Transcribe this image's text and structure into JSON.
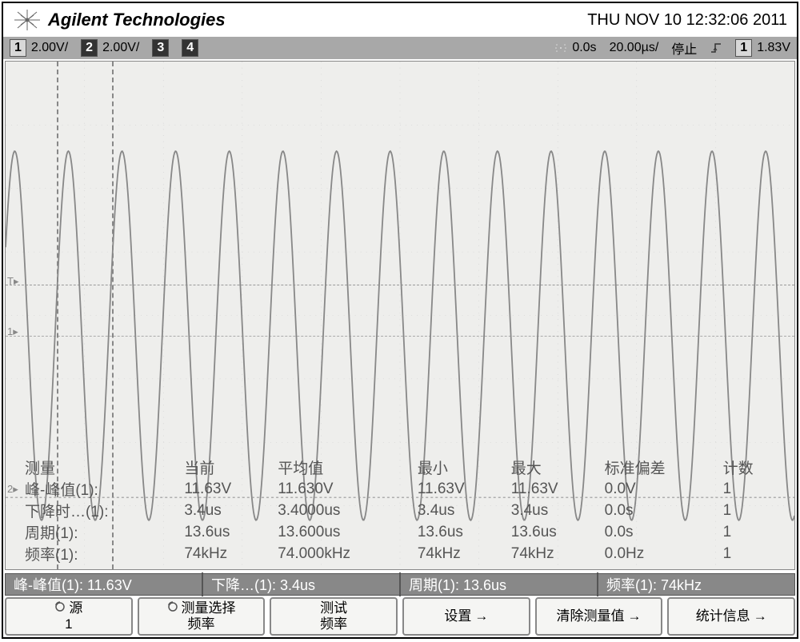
{
  "brand": "Agilent Technologies",
  "timestamp": "THU NOV 10 12:32:06 2011",
  "topbar": {
    "ch1": "1",
    "ch1_vdiv": "2.00V/",
    "ch2": "2",
    "ch2_vdiv": "2.00V/",
    "ch3": "3",
    "ch4": "4",
    "time_pos": "0.0s",
    "time_div": "20.00µs/",
    "run_state": "停止",
    "trig_ch": "1",
    "trig_level": "1.83V"
  },
  "chart_data": {
    "type": "line",
    "signal": "sine",
    "vpp": 11.63,
    "period_us": 13.6,
    "frequency_khz": 74,
    "fall_time_us": 3.4,
    "vdiv": 2.0,
    "time_div_us": 20.0,
    "cycles_visible": 14.7,
    "cursor1_x_div": 0.65,
    "cursor2_x_div": 1.35
  },
  "measurements": {
    "headers": {
      "name": "测量",
      "current": "当前",
      "mean": "平均值",
      "min": "最小",
      "max": "最大",
      "stddev": "标准偏差",
      "count": "计数"
    },
    "rows": [
      {
        "name": "峰-峰值(1):",
        "current": "11.63V",
        "mean": "11.630V",
        "min": "11.63V",
        "max": "11.63V",
        "stddev": "0.0V",
        "count": "1"
      },
      {
        "name": "下降时…(1):",
        "current": "3.4us",
        "mean": "3.4000us",
        "min": "3.4us",
        "max": "3.4us",
        "stddev": "0.0s",
        "count": "1"
      },
      {
        "name": "周期(1):",
        "current": "13.6us",
        "mean": "13.600us",
        "min": "13.6us",
        "max": "13.6us",
        "stddev": "0.0s",
        "count": "1"
      },
      {
        "name": "频率(1):",
        "current": "74kHz",
        "mean": "74.000kHz",
        "min": "74kHz",
        "max": "74kHz",
        "stddev": "0.0Hz",
        "count": "1"
      }
    ]
  },
  "bottom1": {
    "c1": "峰-峰值(1): 11.63V",
    "c2": "下降…(1): 3.4us",
    "c3": "周期(1): 13.6us",
    "c4": "频率(1): 74kHz"
  },
  "softkeys": {
    "k1_line1": "源",
    "k1_line2": "1",
    "k2_line1": "测量选择",
    "k2_line2": "频率",
    "k3_line1": "测试",
    "k3_line2": "频率",
    "k4": "设置",
    "k5": "清除测量值",
    "k6": "统计信息"
  }
}
